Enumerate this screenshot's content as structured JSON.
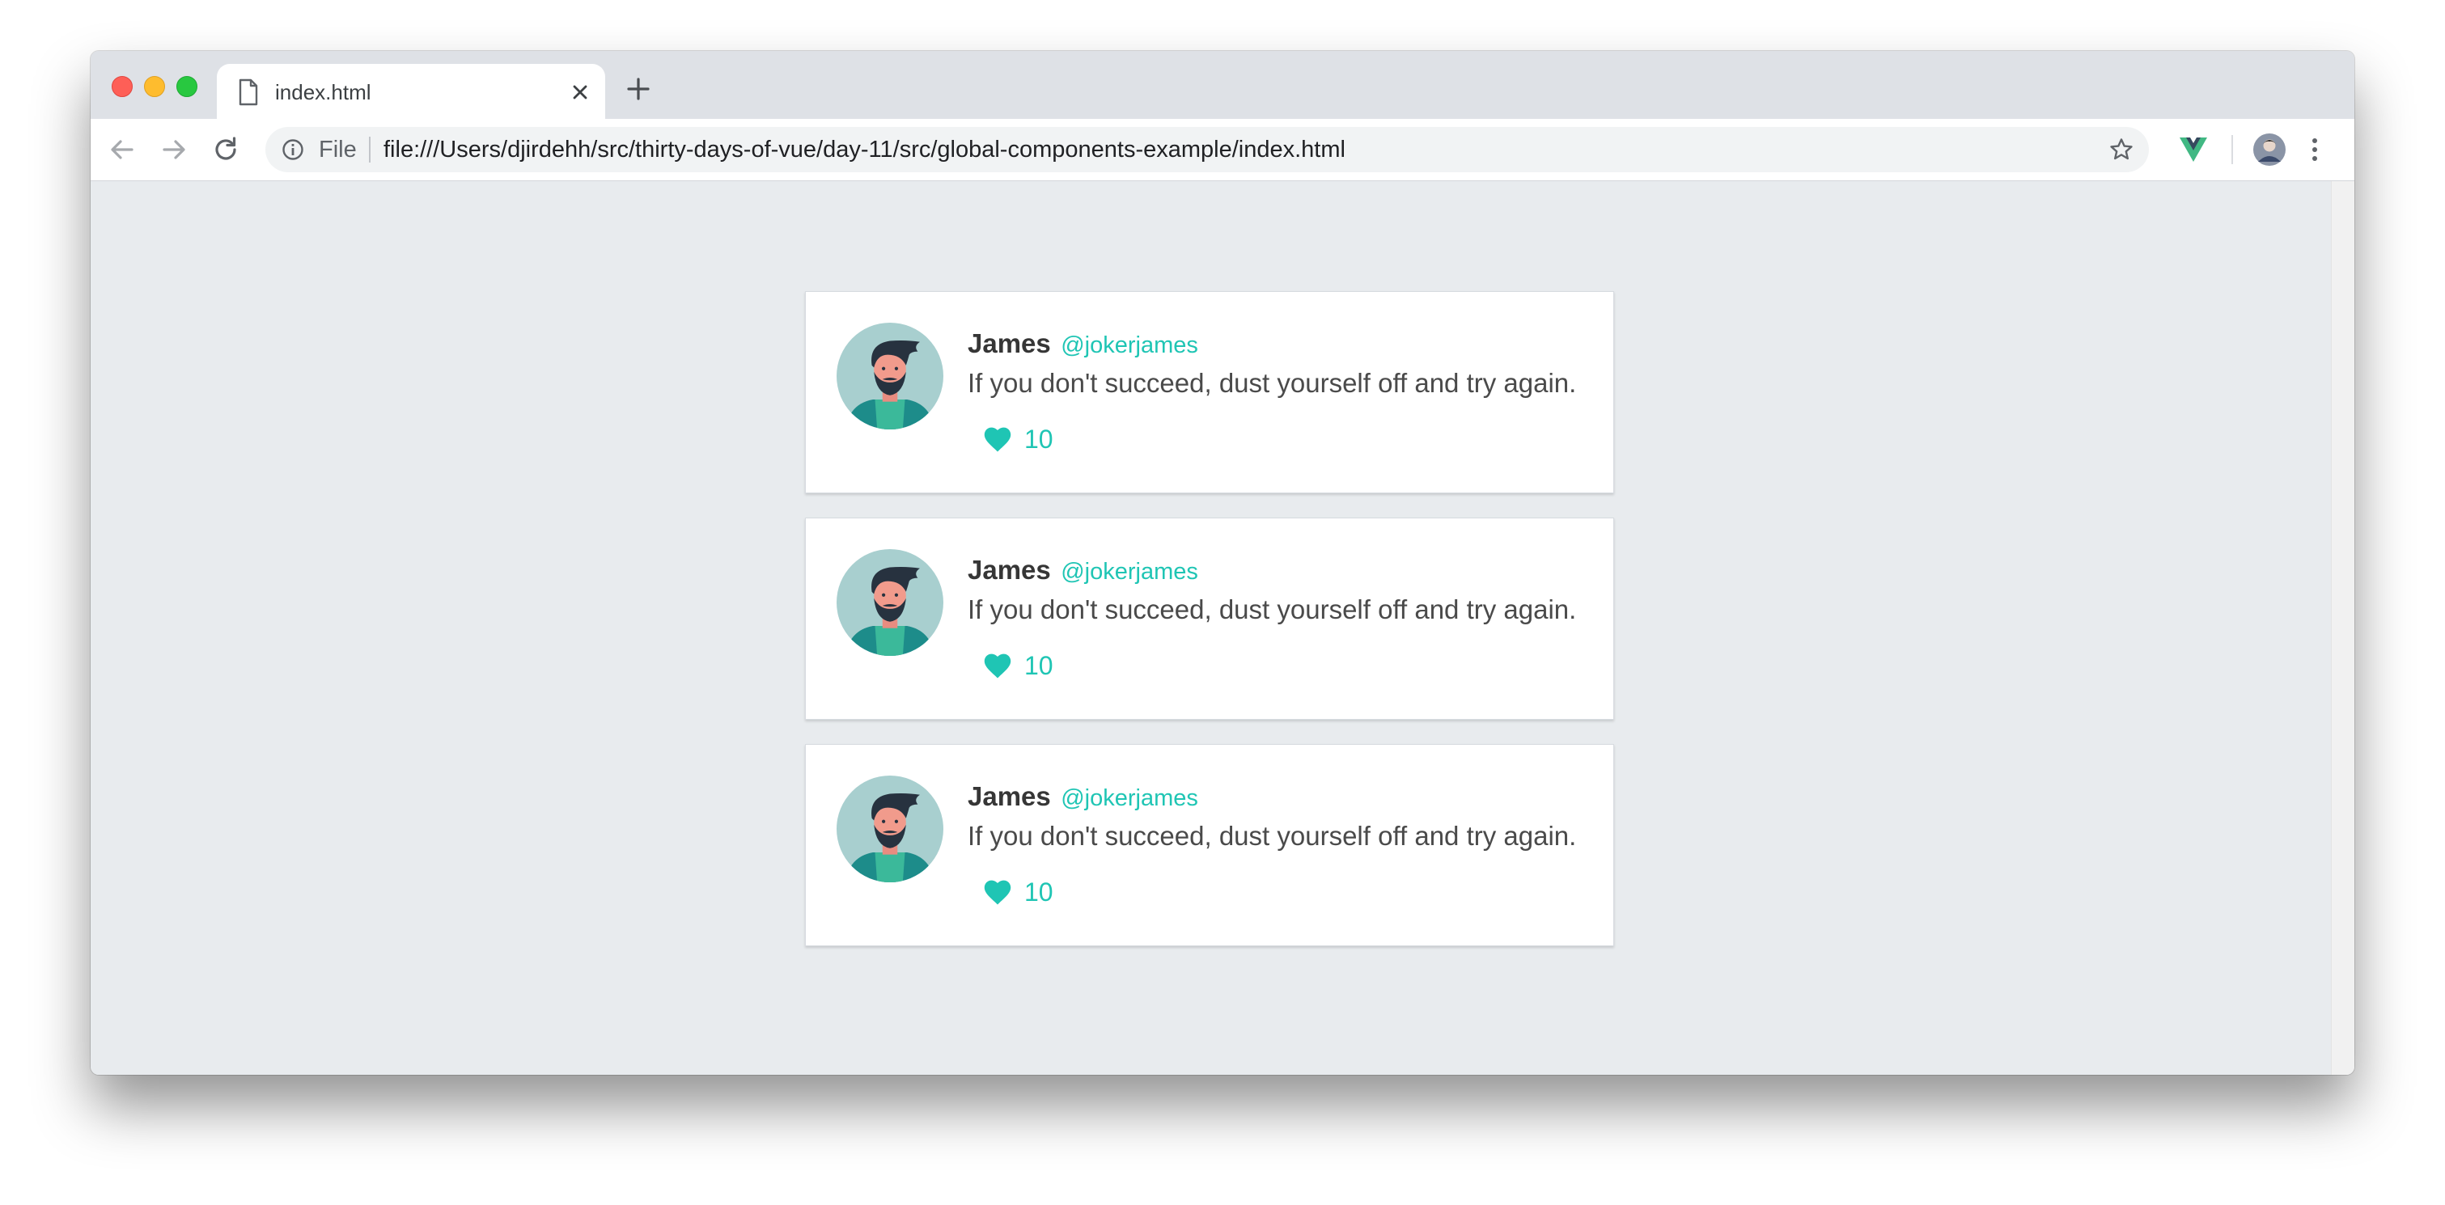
{
  "browser": {
    "tab_title": "index.html",
    "scheme_label": "File",
    "url": "file:///Users/djirdehh/src/thirty-days-of-vue/day-11/src/global-components-example/index.html",
    "icons": {
      "back": "arrow-left-icon",
      "forward": "arrow-right-icon",
      "reload": "reload-icon",
      "info": "info-icon",
      "star": "star-icon",
      "extension": "vue-devtools-icon",
      "profile": "profile-avatar",
      "menu": "kebab-menu-icon",
      "new_tab": "plus-icon",
      "close_tab": "close-icon"
    }
  },
  "colors": {
    "accent": "#1fc5b4",
    "page_background": "#e8ebee",
    "name_text": "#363636",
    "body_text": "#4a4a4a"
  },
  "tweets": [
    {
      "name": "James",
      "handle": "@jokerjames",
      "text": "If you don't succeed, dust yourself off and try again.",
      "likes": "10"
    },
    {
      "name": "James",
      "handle": "@jokerjames",
      "text": "If you don't succeed, dust yourself off and try again.",
      "likes": "10"
    },
    {
      "name": "James",
      "handle": "@jokerjames",
      "text": "If you don't succeed, dust yourself off and try again.",
      "likes": "10"
    }
  ]
}
